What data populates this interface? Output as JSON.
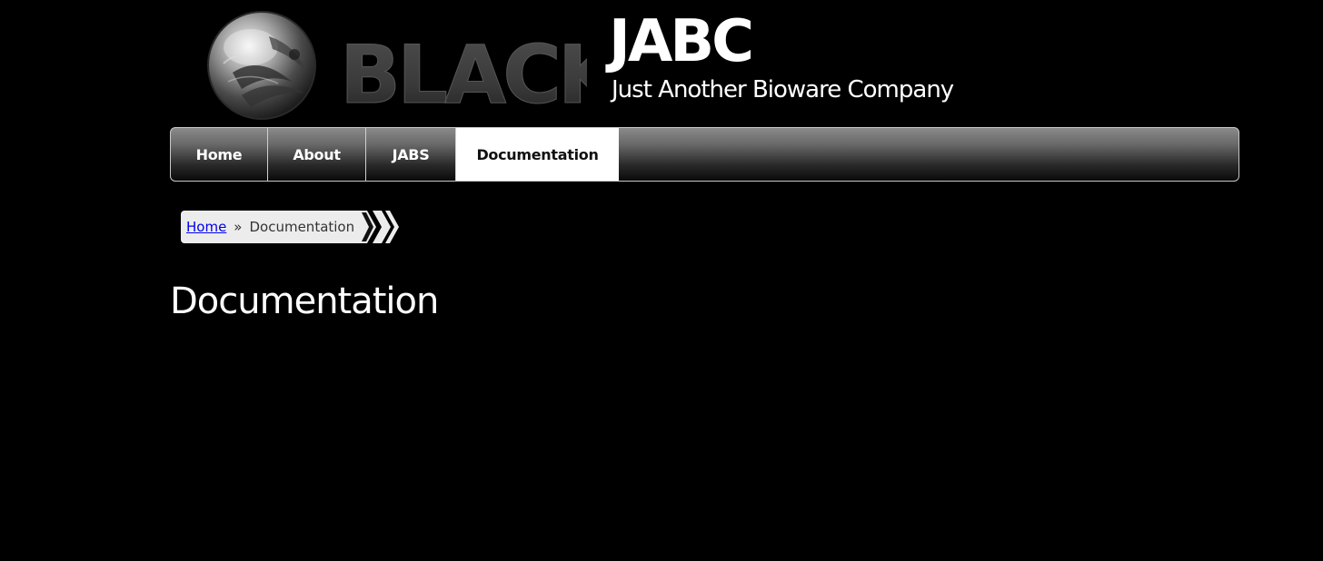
{
  "header": {
    "logo_text": "BLACK",
    "site_title": "JABC",
    "tagline": "Just Another Bioware Company"
  },
  "nav": {
    "items": [
      {
        "label": "Home",
        "active": false
      },
      {
        "label": "About",
        "active": false
      },
      {
        "label": "JABS",
        "active": false
      },
      {
        "label": "Documentation",
        "active": true
      }
    ]
  },
  "breadcrumb": {
    "home_label": "Home",
    "separator": "»",
    "current_label": "Documentation"
  },
  "main": {
    "page_title": "Documentation"
  },
  "colors": {
    "background": "#000000",
    "text": "#ffffff",
    "active_tab_bg": "#ffffff",
    "active_tab_text": "#111111",
    "link": "#0000ee",
    "breadcrumb_bg": "#ececec"
  },
  "icons": {
    "logo_orb": "orb-logo-icon",
    "breadcrumb_arrows": "chevron-right-icon"
  }
}
